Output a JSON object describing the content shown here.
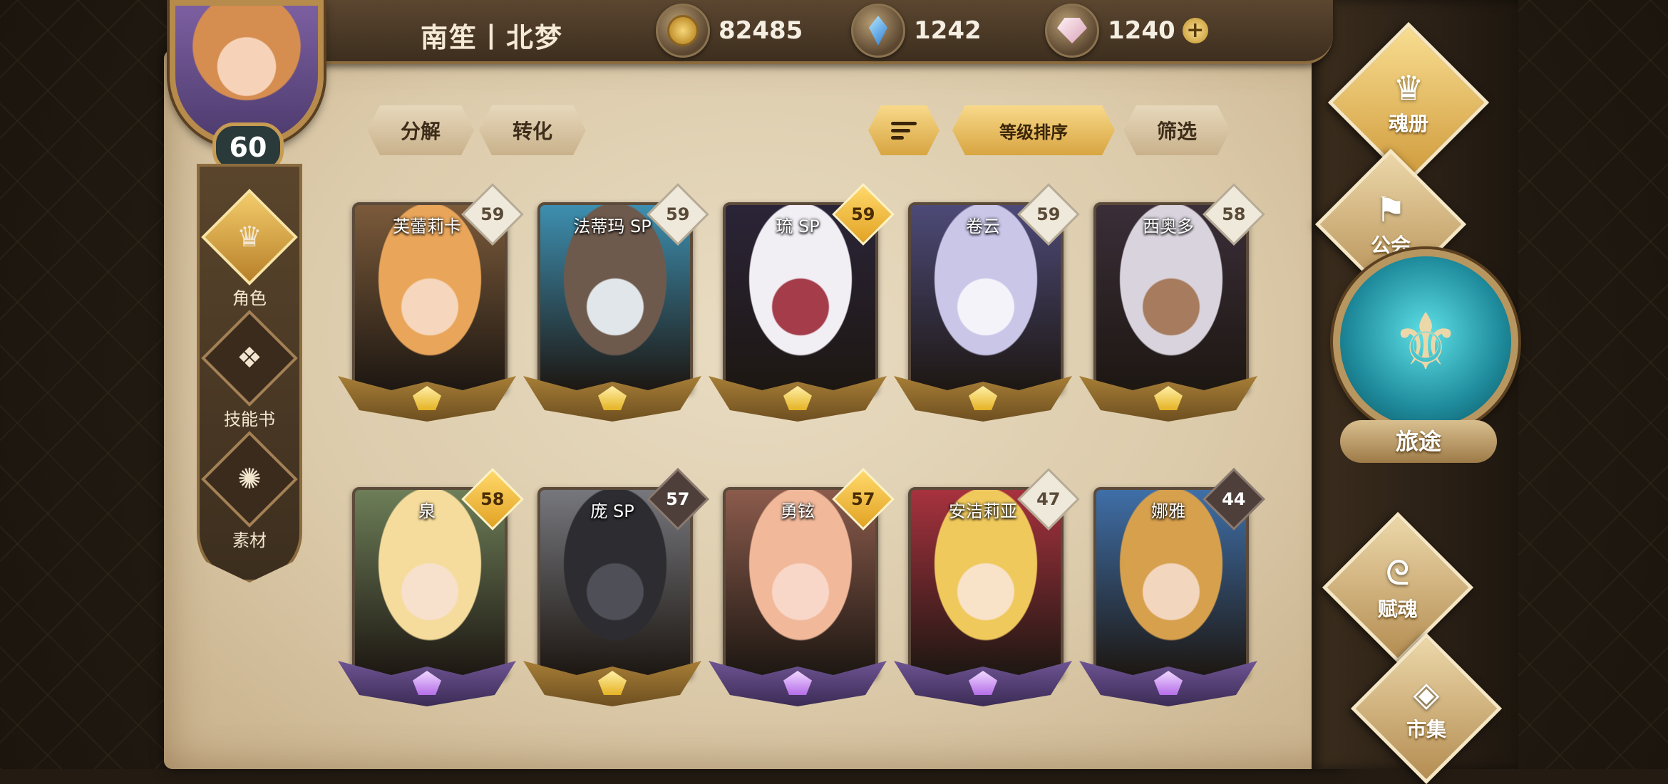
{
  "header": {
    "player_name": "南笙丨北梦",
    "currencies": [
      {
        "name": "gold",
        "icon": "gold-coin-icon",
        "value": "82485"
      },
      {
        "name": "crystal",
        "icon": "blue-crystal-icon",
        "value": "1242"
      },
      {
        "name": "gem",
        "icon": "pink-gem-icon",
        "value": "1240"
      }
    ],
    "add_label": "+"
  },
  "player": {
    "level": "60"
  },
  "left_nav": [
    {
      "label": "角色",
      "icon": "helmet-icon",
      "active": true
    },
    {
      "label": "技能书",
      "icon": "skill-book-icon",
      "active": false
    },
    {
      "label": "素材",
      "icon": "material-icon",
      "active": false
    }
  ],
  "toolbar": {
    "decompose": "分解",
    "convert": "转化",
    "sort_by_level": "等级排序",
    "filter": "筛选"
  },
  "heroes": [
    {
      "name": "芙蕾莉卡",
      "level": "59",
      "badge": "silver",
      "frame": "gold",
      "colors": [
        "#e9a65b",
        "#f6d7bd",
        "#7b5a3a"
      ]
    },
    {
      "name": "法蒂玛 SP",
      "level": "59",
      "badge": "silver",
      "frame": "gold",
      "colors": [
        "#6e5a4d",
        "#e0e6ea",
        "#3d8fb0"
      ]
    },
    {
      "name": "琉 SP",
      "level": "59",
      "badge": "gold",
      "frame": "gold",
      "colors": [
        "#f1eef4",
        "#a53c4a",
        "#2b2438"
      ]
    },
    {
      "name": "卷云",
      "level": "59",
      "badge": "silver",
      "frame": "gold",
      "colors": [
        "#c9c6e8",
        "#f5f3fa",
        "#4d4a78"
      ]
    },
    {
      "name": "西奥多",
      "level": "58",
      "badge": "silver",
      "frame": "gold",
      "colors": [
        "#d9d3dd",
        "#a77b5d",
        "#3a2e38"
      ]
    },
    {
      "name": "泉",
      "level": "58",
      "badge": "gold",
      "frame": "purple",
      "colors": [
        "#f5dc9c",
        "#f7e0cc",
        "#6d7e58"
      ]
    },
    {
      "name": "庞 SP",
      "level": "57",
      "badge": "dark",
      "frame": "gold",
      "colors": [
        "#2c2c31",
        "#4e4f57",
        "#76777d"
      ]
    },
    {
      "name": "勇铉",
      "level": "57",
      "badge": "gold",
      "frame": "purple",
      "colors": [
        "#f1b89a",
        "#f9d7c8",
        "#8b5b4c"
      ]
    },
    {
      "name": "安洁莉亚",
      "level": "47",
      "badge": "silver",
      "frame": "purple",
      "colors": [
        "#f0c95c",
        "#f8e2c8",
        "#a7323e"
      ]
    },
    {
      "name": "娜雅",
      "level": "44",
      "badge": "dark",
      "frame": "purple",
      "colors": [
        "#d7a04d",
        "#f3d6be",
        "#3f6fa8"
      ]
    }
  ],
  "right_nav": {
    "soul_book": "魂册",
    "guild": "公会",
    "journey": "旅途",
    "endow_soul": "赋魂",
    "market": "市集"
  }
}
